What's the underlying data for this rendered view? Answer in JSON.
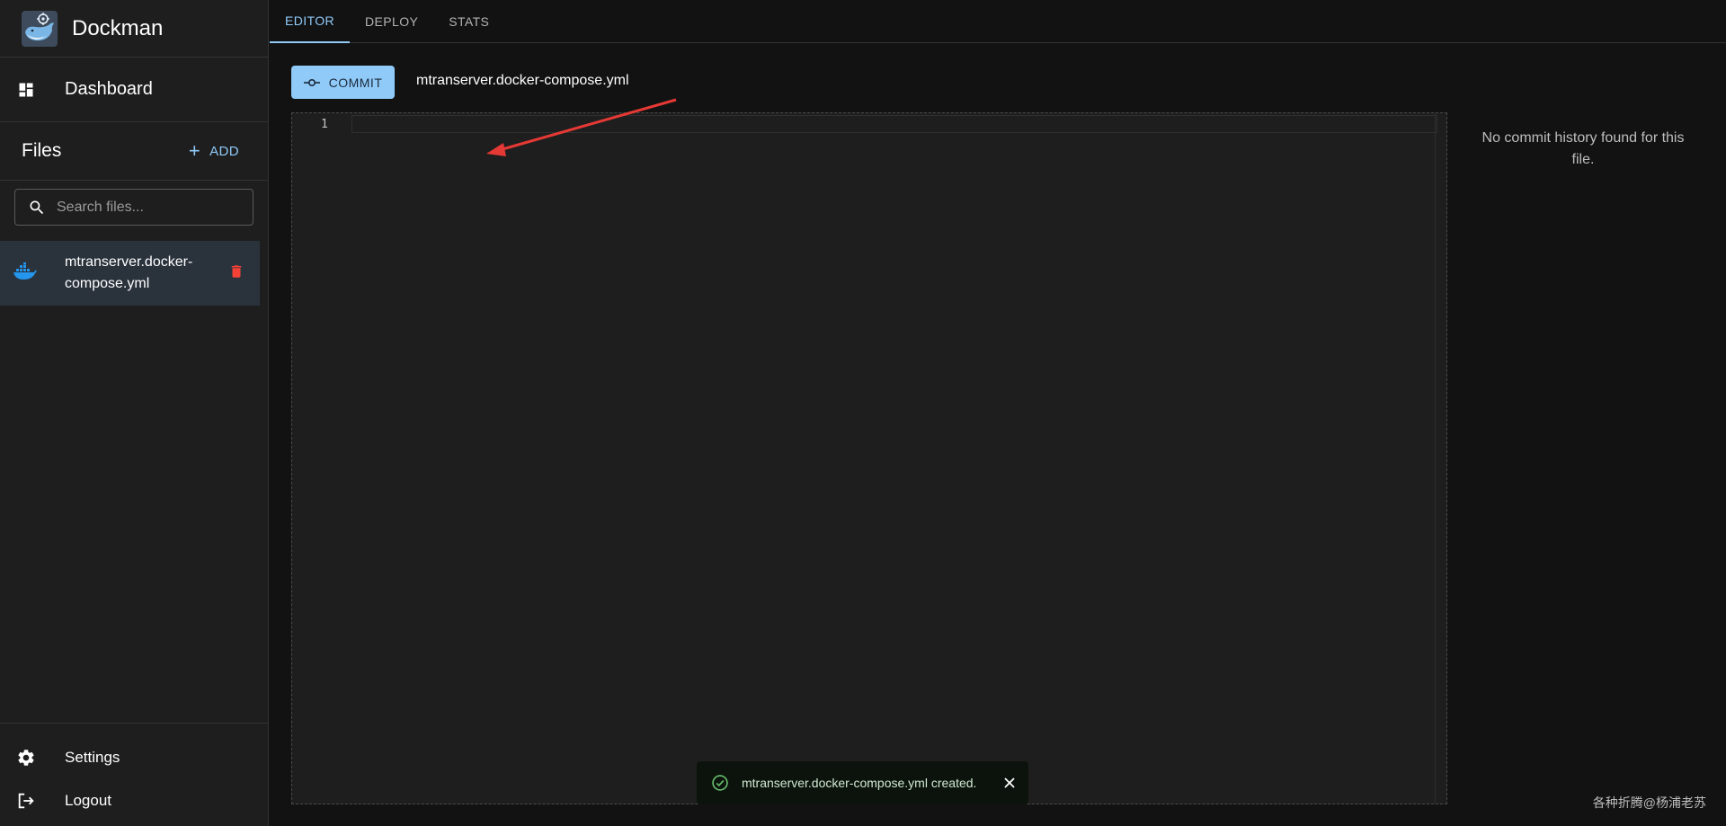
{
  "app": {
    "title": "Dockman",
    "logo_icon": "docker-whale-logo",
    "accent_color": "#90caf9"
  },
  "sidebar": {
    "nav": [
      {
        "label": "Dashboard",
        "icon": "dashboard-icon"
      }
    ],
    "files": {
      "title": "Files",
      "add_label": "ADD",
      "search_placeholder": "Search files...",
      "items": [
        {
          "name": "mtranserver.docker-compose.yml",
          "icon": "docker-icon",
          "selected": true
        }
      ]
    },
    "bottom": [
      {
        "label": "Settings",
        "icon": "gear-icon"
      },
      {
        "label": "Logout",
        "icon": "logout-icon"
      }
    ]
  },
  "tabs": [
    {
      "label": "EDITOR",
      "active": true
    },
    {
      "label": "DEPLOY",
      "active": false
    },
    {
      "label": "STATS",
      "active": false
    }
  ],
  "toolbar": {
    "commit_label": "COMMIT",
    "current_file": "mtranserver.docker-compose.yml"
  },
  "editor": {
    "line_numbers": [
      "1"
    ],
    "content": ""
  },
  "history": {
    "empty_message": "No commit history found for this file."
  },
  "snackbar": {
    "message": "mtranserver.docker-compose.yml created.",
    "status": "success"
  },
  "watermark": "各种折腾@杨浦老苏"
}
